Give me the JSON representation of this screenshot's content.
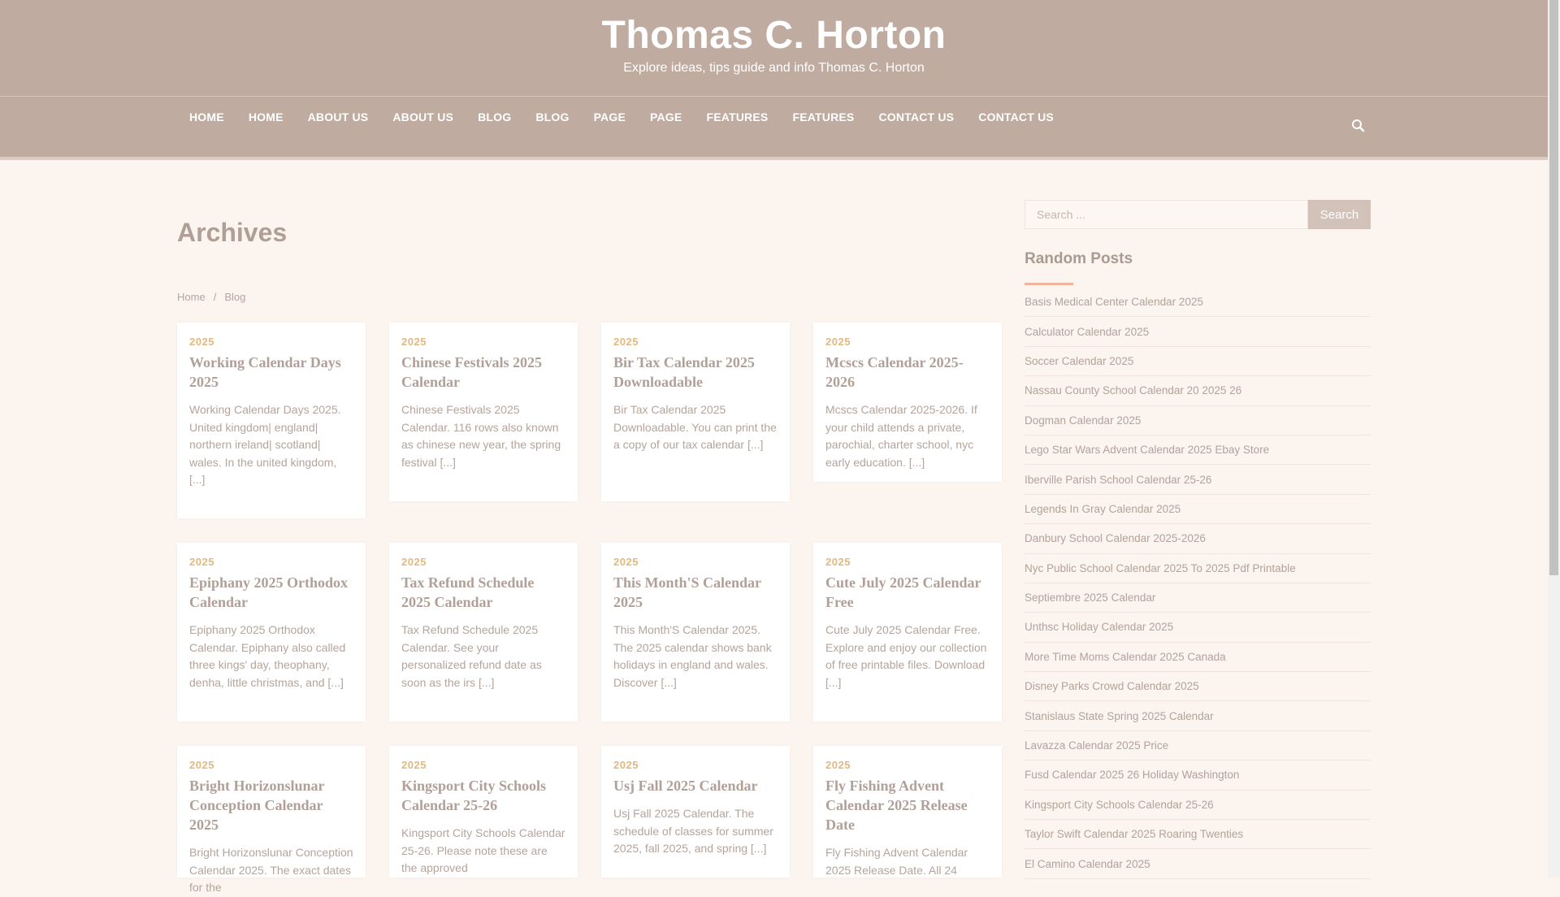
{
  "site": {
    "title": "Thomas C. Horton",
    "description": "Explore ideas, tips guide and info Thomas C. Horton"
  },
  "nav": [
    "HOME",
    "HOME",
    "ABOUT US",
    "ABOUT US",
    "BLOG",
    "BLOG",
    "PAGE",
    "PAGE",
    "FEATURES",
    "FEATURES",
    "CONTACT US",
    "CONTACT US"
  ],
  "page_title": "Archives",
  "breadcrumb": {
    "home": "Home",
    "separator": "/",
    "current": "Blog"
  },
  "posts": [
    {
      "category": "2025",
      "title": "Working Calendar Days 2025",
      "excerpt": "Working Calendar Days 2025. United kingdom| england| northern ireland| scotland| wales. In the united kingdom, [...]"
    },
    {
      "category": "2025",
      "title": "Chinese Festivals 2025 Calendar",
      "excerpt": "Chinese Festivals 2025 Calendar. 116 rows also known as chinese new year, the spring festival [...]"
    },
    {
      "category": "2025",
      "title": "Bir Tax Calendar 2025 Downloadable",
      "excerpt": "Bir Tax Calendar 2025 Downloadable. You can print the a copy of our tax calendar [...]"
    },
    {
      "category": "2025",
      "title": "Mcscs Calendar 2025-2026",
      "excerpt": "Mcscs Calendar 2025-2026. If your child attends a private, parochial, charter school, nyc early education. [...]"
    },
    {
      "category": "2025",
      "title": "Epiphany 2025 Orthodox Calendar",
      "excerpt": "Epiphany 2025 Orthodox Calendar. Epiphany also called three kings' day, theophany, denha, little christmas, and [...]"
    },
    {
      "category": "2025",
      "title": "Tax Refund Schedule 2025 Calendar",
      "excerpt": "Tax Refund Schedule 2025 Calendar. See your personalized refund date as soon as the irs [...]"
    },
    {
      "category": "2025",
      "title": "This Month'S Calendar 2025",
      "excerpt": "This Month'S Calendar 2025. The 2025 calendar shows bank holidays in england and wales. Discover [...]"
    },
    {
      "category": "2025",
      "title": "Cute July 2025 Calendar Free",
      "excerpt": "Cute July 2025 Calendar Free. Explore and enjoy our collection of free printable files. Download [...]"
    },
    {
      "category": "2025",
      "title": "Bright Horizonslunar Conception Calendar 2025",
      "excerpt": "Bright Horizonslunar Conception Calendar 2025. The exact dates for the"
    },
    {
      "category": "2025",
      "title": "Kingsport City Schools Calendar 25-26",
      "excerpt": "Kingsport City Schools Calendar 25-26. Please note these are the approved"
    },
    {
      "category": "2025",
      "title": "Usj Fall 2025 Calendar",
      "excerpt": "Usj Fall 2025 Calendar. The schedule of classes for summer 2025, fall 2025, and spring [...]"
    },
    {
      "category": "2025",
      "title": "Fly Fishing Advent Calendar 2025 Release Date",
      "excerpt": "Fly Fishing Advent Calendar 2025 Release Date. All 24"
    }
  ],
  "sidebar": {
    "search_placeholder": "Search ...",
    "search_button": "Search",
    "random_posts_title": "Random Posts",
    "random_posts": [
      "Basis Medical Center Calendar 2025",
      "Calculator Calendar 2025",
      "Soccer Calendar 2025",
      "Nassau County School Calendar 20 2025 26",
      "Dogman Calendar 2025",
      "Lego Star Wars Advent Calendar 2025 Ebay Store",
      "Iberville Parish School Calendar 25-26",
      "Legends In Gray Calendar 2025",
      "Danbury School Calendar 2025-2026",
      "Nyc Public School Calendar 2025 To 2025 Pdf Printable",
      "Septiembre 2025 Calendar",
      "Unthsc Holiday Calendar 2025",
      "More Time Moms Calendar 2025 Canada",
      "Disney Parks Crowd Calendar 2025",
      "Stanislaus State Spring 2025 Calendar",
      "Lavazza Calendar 2025 Price",
      "Fusd Calendar 2025 26 Holiday Washington",
      "Kingsport City Schools Calendar 25-26",
      "Taylor Swift Calendar 2025 Roaring Twenties",
      "El Camino Calendar 2025"
    ]
  }
}
